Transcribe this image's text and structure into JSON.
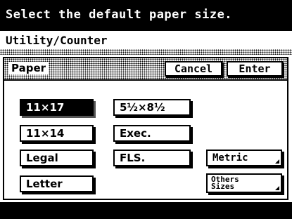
{
  "header": {
    "message": "Select the default paper size."
  },
  "breadcrumb": {
    "title": "Utility/Counter"
  },
  "dialog": {
    "title": "Paper",
    "cancel_label": "Cancel",
    "enter_label": "Enter"
  },
  "sizes": {
    "s11x17": "11×17",
    "s11x14": "11×14",
    "legal": "Legal",
    "letter": "Letter",
    "s5x8": "5½×8½",
    "exec": "Exec.",
    "fls": "FLS.",
    "metric": "Metric",
    "others_line1": "Others",
    "others_line2": "Sizes"
  },
  "selected": "11×17"
}
